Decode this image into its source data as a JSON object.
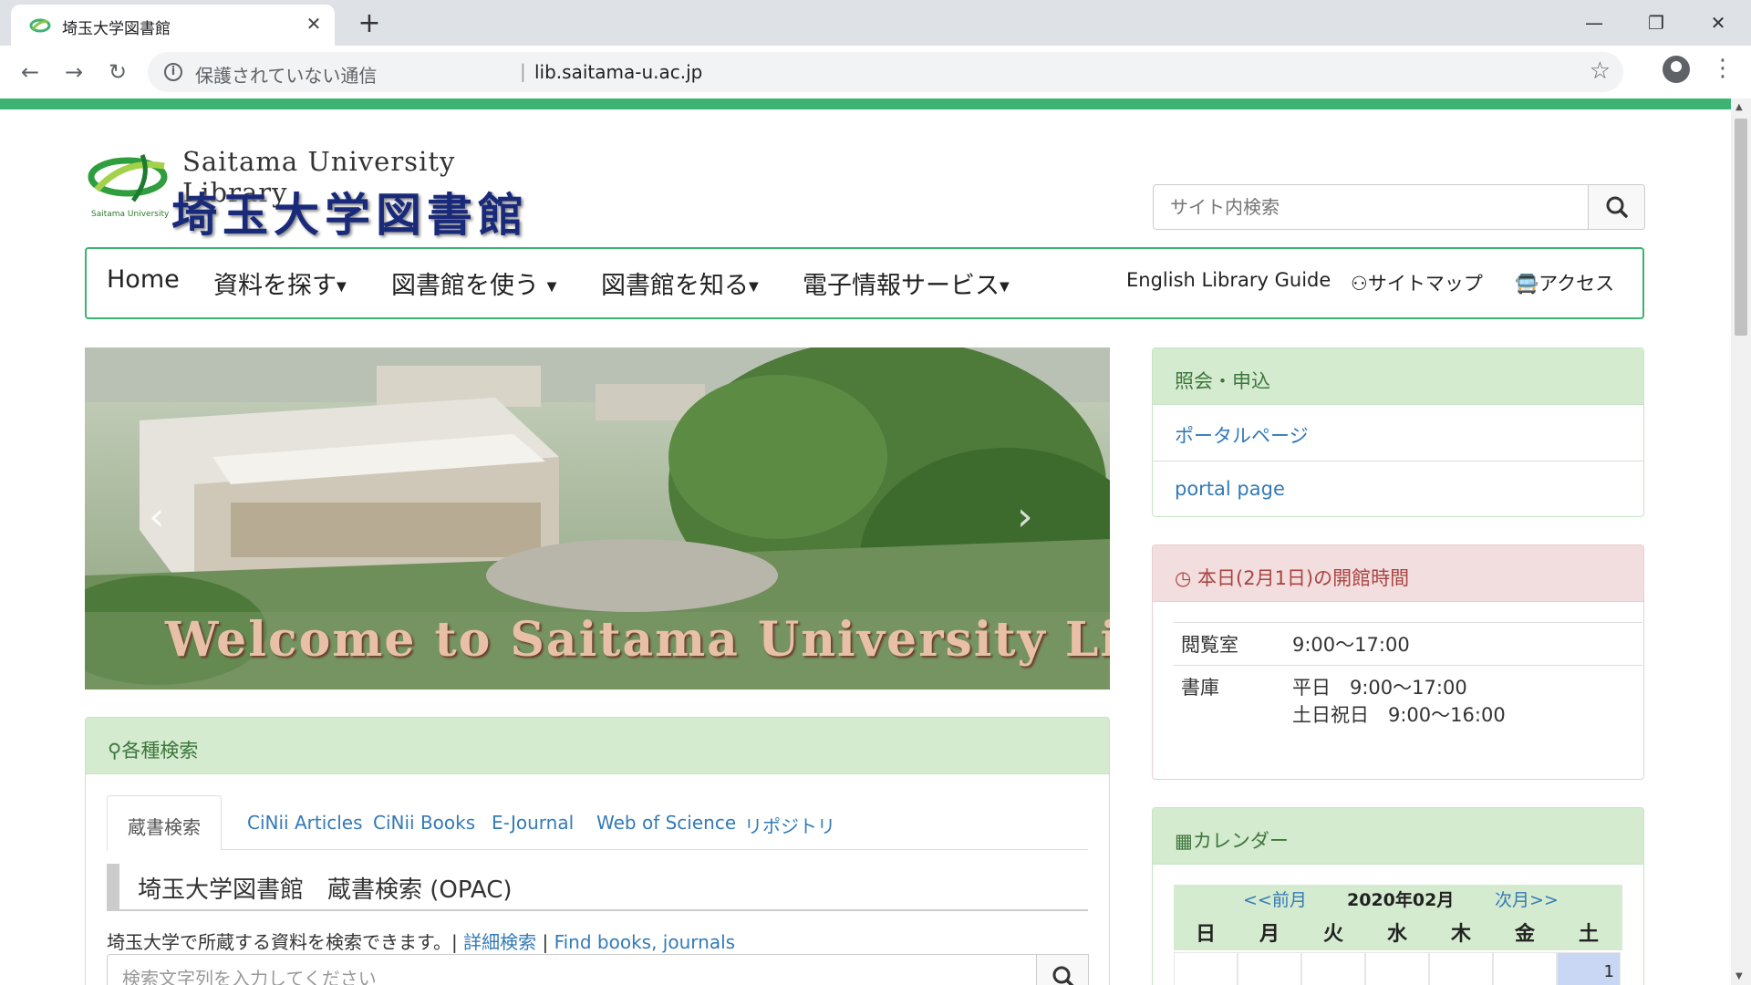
{
  "browser": {
    "tab_title": "埼玉大学図書館",
    "tab_close": "✕",
    "new_tab": "+",
    "security_text": "保護されていない通信",
    "url": "lib.saitama-u.ac.jp",
    "icons": [
      "favicon-icon",
      "close-icon",
      "plus-icon",
      "back-icon",
      "forward-icon",
      "reload-icon",
      "info-icon",
      "star-icon",
      "account-icon",
      "menu-icon",
      "minimize-icon",
      "restore-icon",
      "window-close-icon"
    ]
  },
  "header": {
    "logo_en": "Saitama University Library",
    "logo_jp": "埼玉大学図書館",
    "logo_small": "Saitama University",
    "search_placeholder": "サイト内検索"
  },
  "nav": {
    "home": "Home",
    "find": "資料を探す",
    "use": "図書館を使う",
    "know": "図書館を知る",
    "eservice": "電子情報サービス",
    "english": "English Library Guide",
    "sitemap": "サイトマップ",
    "access": "アクセス"
  },
  "carousel": {
    "caption": "Welcome to Saitama University Library"
  },
  "search_panel": {
    "heading": "各種検索",
    "tabs": [
      "蔵書検索",
      "CiNii Articles",
      "CiNii Books",
      "E-Journal",
      "Web of Science",
      "リポジトリ"
    ],
    "active_tab": "蔵書検索",
    "opac_title": "埼玉大学図書館　蔵書検索 (OPAC)",
    "desc": "埼玉大学で所蔵する資料を検索できます。|",
    "detail_link": "詳細検索",
    "sep": "|",
    "find_link": "Find books, journals",
    "input_placeholder": "検索文字列を入力してください"
  },
  "inquiry": {
    "heading": "照会・申込",
    "links": [
      "ポータルページ",
      "portal page"
    ]
  },
  "hours": {
    "heading": "本日(2月1日)の開館時間",
    "rows": [
      {
        "label": "閲覧室",
        "lines": [
          "9:00〜17:00"
        ]
      },
      {
        "label": "書庫",
        "lines": [
          "平日　9:00〜17:00",
          "土日祝日　9:00〜16:00"
        ]
      }
    ]
  },
  "calendar": {
    "heading": "カレンダー",
    "prev": "<<前月",
    "month": "2020年02月",
    "next": "次月>>",
    "days_of_week": [
      "日",
      "月",
      "火",
      "水",
      "木",
      "金",
      "土"
    ],
    "first_row": [
      "",
      "",
      "",
      "",
      "",
      "",
      "1"
    ]
  },
  "colors": {
    "accent_green": "#3cb371",
    "panel_green": "#d5ebcf",
    "panel_red": "#f2dede",
    "link_blue": "#337ab7",
    "logo_navy": "#1a2a7a"
  }
}
